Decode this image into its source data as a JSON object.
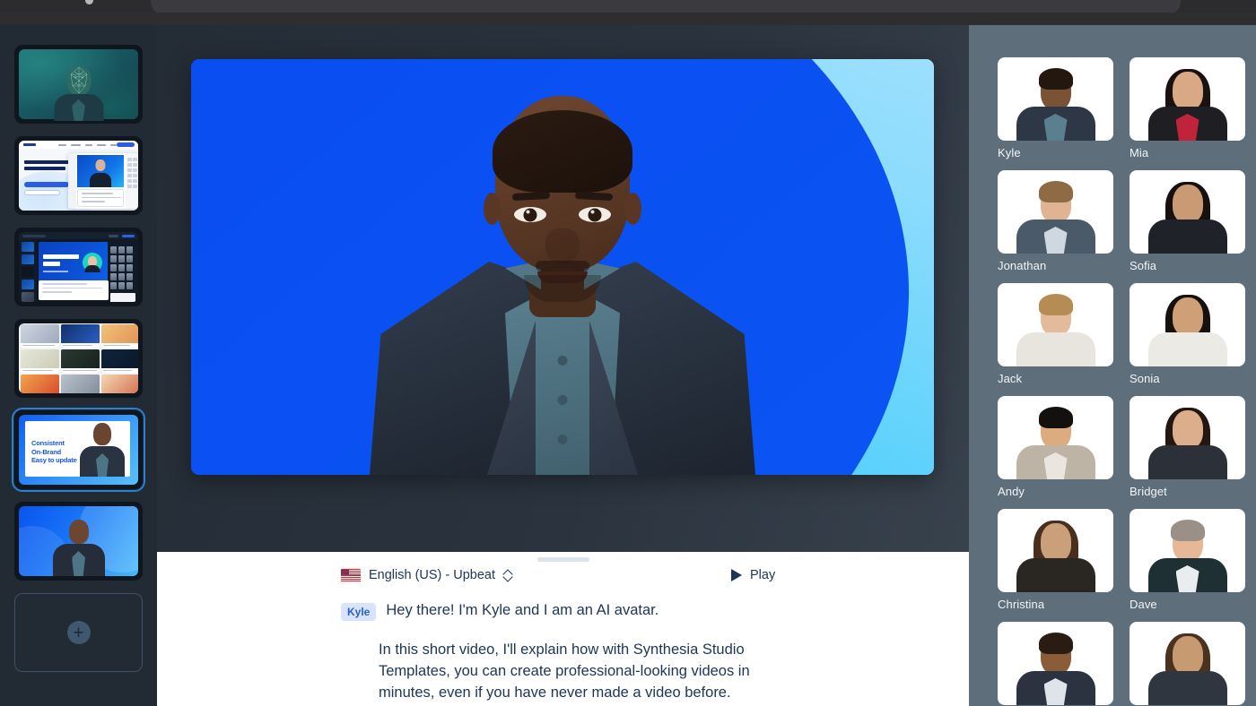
{
  "browser": {
    "omnibox_text": "",
    "menu_icon": "kebab-menu-icon"
  },
  "slide_rail": {
    "add_slide_label": "+",
    "slides": [
      {
        "id": "slide-1",
        "name": "face-mesh-avatar-slide",
        "selected": false
      },
      {
        "id": "slide-2",
        "name": "website-screenshot-slide",
        "selected": false,
        "headline": "Here's an AI video maker that turns text into video"
      },
      {
        "id": "slide-3",
        "name": "insert-title-editor-slide",
        "selected": false,
        "title_line_1": "INSERT TITLE",
        "title_line_2": "HERE",
        "subtitle": "INSERT SUBTITLE HERE"
      },
      {
        "id": "slide-4",
        "name": "template-gallery-slide",
        "selected": false
      },
      {
        "id": "slide-5",
        "name": "consistent-on-brand-slide",
        "selected": true,
        "text_line_1": "Consistent",
        "text_line_2": "On-Brand",
        "text_line_3": "Easy to update"
      },
      {
        "id": "slide-6",
        "name": "blue-gradient-avatar-slide",
        "selected": false
      }
    ]
  },
  "canvas": {
    "name": "video-canvas",
    "background_colors": {
      "deep_blue": "#0b4ef0",
      "mid_blue": "#1278f6",
      "cyan": "#37b6fa",
      "light_blue": "#a6dffd",
      "periwinkle": "#b8c4f4"
    },
    "presenter_name": "Kyle"
  },
  "script_panel": {
    "language_label": "English (US) - Upbeat",
    "language_flag": "us-flag-icon",
    "language_chevron": "chevron-up-down-icon",
    "play_label": "Play",
    "play_icon": "play-triangle-icon",
    "speaker_badge": "Kyle",
    "line_1": "Hey there! I'm Kyle and I am an AI avatar.",
    "paragraph_2": "In this short video, I'll explain how with Synthesia Studio Templates, you can create professional-looking videos in minutes, even if you have never made a video before."
  },
  "avatar_panel": {
    "name": "avatar-library",
    "avatars": [
      {
        "label": "Kyle",
        "skin": "#7a5236",
        "hair": "#241710",
        "hair_style": "short",
        "jacket": "#2d3745",
        "shirt": "#5b7f8f"
      },
      {
        "label": "Mia",
        "skin": "#d9a884",
        "hair": "#1a1210",
        "hair_style": "long",
        "jacket": "#1f1f23",
        "shirt": "#c0243a"
      },
      {
        "label": "Jonathan",
        "skin": "#e0b392",
        "hair": "#8e6b45",
        "hair_style": "short",
        "jacket": "#4b5a68",
        "shirt": "#cfd8e0"
      },
      {
        "label": "Sofia",
        "skin": "#c99a73",
        "hair": "#18100e",
        "hair_style": "long",
        "jacket": "#20222a",
        "shirt": "#20222a"
      },
      {
        "label": "Jack",
        "skin": "#e3bb9c",
        "hair": "#b68c55",
        "hair_style": "short",
        "jacket": "#e8e5de",
        "shirt": "#e8e5de"
      },
      {
        "label": "Sonia",
        "skin": "#cf9f77",
        "hair": "#16100e",
        "hair_style": "long",
        "jacket": "#eceae4",
        "shirt": "#eceae4"
      },
      {
        "label": "Andy",
        "skin": "#ddab80",
        "hair": "#14100e",
        "hair_style": "short",
        "jacket": "#bdb4a6",
        "shirt": "#eae6df"
      },
      {
        "label": "Bridget",
        "skin": "#dcae8b",
        "hair": "#241611",
        "hair_style": "long",
        "jacket": "#2c3038",
        "shirt": "#2c3038"
      },
      {
        "label": "Christina",
        "skin": "#caa07a",
        "hair": "#4a2f1e",
        "hair_style": "long",
        "jacket": "#2a2722",
        "shirt": "#2a2722"
      },
      {
        "label": "Dave",
        "skin": "#e6b897",
        "hair": "#9a9088",
        "hair_style": "short",
        "jacket": "#1f3035",
        "shirt": "#e9edf0"
      },
      {
        "label": "",
        "skin": "#8a5c3a",
        "hair": "#2a1c12",
        "hair_style": "short",
        "jacket": "#2b3240",
        "shirt": "#dfe4ea"
      },
      {
        "label": "",
        "skin": "#c79a72",
        "hair": "#4a3120",
        "hair_style": "long",
        "jacket": "#303640",
        "shirt": "#303640"
      }
    ]
  }
}
